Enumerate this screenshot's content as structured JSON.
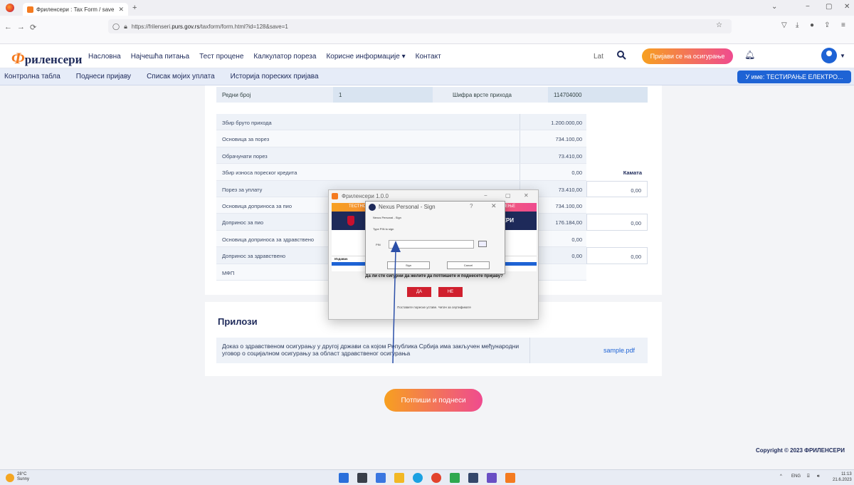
{
  "browser": {
    "tab_title": "Фриленсери : Tax Form / save",
    "tab_close": "✕",
    "new_tab": "+",
    "url_prefix": "https://frilenseri.",
    "url_host": "purs.gov.rs",
    "url_path": "/taxform/form.html?id=128&save=1",
    "back": "←",
    "forward": "→",
    "reload": "⟳",
    "win_min": "−",
    "win_max": "▢",
    "win_close": "✕",
    "tabs_menu": "⌄"
  },
  "site": {
    "logo_prefix": "Ф",
    "logo_rest": "рилeнсери",
    "nav": [
      "Насловна",
      "Најчешћа питања",
      "Тест процене",
      "Калкулатор пореза",
      "Корисне информације ▾",
      "Контакт"
    ],
    "lang": "Lat",
    "login_button": "Пријави се на осигурање",
    "subnav": [
      "Контролна табла",
      "Поднеси пријаву",
      "Списак мојих уплата",
      "Историја пореских пријава"
    ],
    "user_badge": "У име: ТЕСТИРАЊЕ ЕЛЕКТРО..."
  },
  "form": {
    "top_row": {
      "label1": "Редни број",
      "value1": "1",
      "label2": "Шифра врсте прихода",
      "value2": "114704000"
    },
    "rows": [
      {
        "label": "Збир бруто прихода",
        "amount": "1.200.000,00"
      },
      {
        "label": "Основица за порез",
        "amount": "734.100,00"
      },
      {
        "label": "Обрачунати порез",
        "amount": "73.410,00"
      },
      {
        "label": "Збир износа пореског кредита",
        "amount": "0,00"
      },
      {
        "label": "Порез за уплату",
        "amount": "73.410,00"
      },
      {
        "label": "Основица доприноса за пио",
        "amount": "734.100,00"
      },
      {
        "label": "Допринос за пио",
        "amount": "176.184,00"
      },
      {
        "label": "Основица доприноса за здравствено",
        "amount": "0,00"
      },
      {
        "label": "Допринос за здравствено",
        "amount": "0,00"
      },
      {
        "label": "МФП",
        "amount": ""
      }
    ],
    "kamata_header": "Камата",
    "kamata_values": [
      "0,00",
      "0,00",
      "0,00"
    ]
  },
  "attachments": {
    "title": "Прилози",
    "description": "Доказ о здравственом осигурању у другој држави са којом Република Србија има закључен међународни уговор о социјалном осигурању за област здравственог осигурања",
    "file": "sample.pdf"
  },
  "sign_button": "Потпиши и поднеси",
  "copyright": "Copyright © 2023 ФРИЛЕНСЕРИ",
  "app_dialog": {
    "title": "Фриленсери 1.0.0",
    "banner_left": "ТЕСТНО О",
    "banner_right": "ОКРУЖЕЊЕ",
    "band_text": "ЕНСЕРИ",
    "list_header": "Издавач",
    "confirm_text": "Да ли сте сигурни да желите да потпишете и поднесете пријаву?",
    "yes": "ДА",
    "no": "НЕ",
    "footnote": "Поставите пореске уставе. Читач за сертификате"
  },
  "sign_dialog": {
    "title": "Nexus Personal - Sign",
    "help": "?",
    "close": "✕",
    "line1": "Nexus Personal - Sign",
    "line2": "Type PIN to sign",
    "pin_label": "PIN",
    "ok": "Sign",
    "cancel": "Cancel"
  },
  "taskbar": {
    "temp": "28°C",
    "weather": "Sunny",
    "lang": "ENG",
    "time": "11:13",
    "date": "21.6.2023",
    "tray_caret": "^"
  },
  "colors": {
    "navy": "#1e2a5a",
    "accent_orange": "#f7a020",
    "accent_pink": "#ef4b8f",
    "link_blue": "#1e63d5",
    "dialog_red": "#d0202e"
  }
}
